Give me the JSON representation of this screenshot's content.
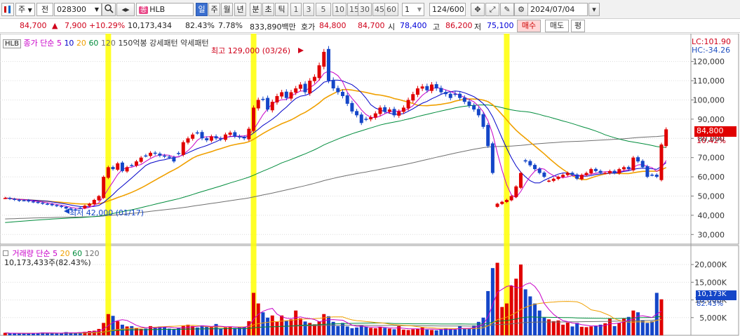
{
  "toolbar": {
    "market_type": "주",
    "scope": "전",
    "code": "028300",
    "stock_name": "HLB",
    "stock_badge": "종",
    "periods": [
      "일",
      "주",
      "월",
      "년",
      "분",
      "초",
      "틱"
    ],
    "active_period": "일",
    "intervals": [
      "1",
      "3",
      "5",
      "10",
      "15",
      "30",
      "45",
      "60"
    ],
    "interval_value": "1",
    "count": "124",
    "count_total": "/600",
    "date": "2024/07/04"
  },
  "quote": {
    "price": "84,700",
    "change_arrow": "▲",
    "change": "7,900",
    "change_pct": "+10.29%",
    "volume": "10,173,434",
    "volume_ratio": "82.43%",
    "turnover": "7.78%",
    "amount": "833,890백만",
    "ask_label": "호가",
    "ask": "84,800",
    "bid": "84,700",
    "open_label": "시",
    "open": "78,400",
    "high_label": "고",
    "high": "86,200",
    "low_label": "저",
    "low": "75,100",
    "buy_label": "매수",
    "sell_label": "매도",
    "avg_label": "평"
  },
  "price_panel": {
    "stock_tag": "HLB",
    "ma_label": "종가 단순",
    "ma_periods": [
      "5",
      "10",
      "20",
      "60",
      "120"
    ],
    "extra_label": "150억봉 강세패턴  약세패턴",
    "high_annotation": "최고 129,000 (03/26)",
    "low_annotation": "최저 42,000 (01/17)",
    "lc_label": "LC:101.90",
    "hc_label": "HC:-34.26",
    "last_price_tag": "84,800",
    "last_pct_tag": "10.42%",
    "colors": {
      "ma5": "#c800c8",
      "ma10": "#0000c8",
      "ma20": "#f0a000",
      "ma60": "#008c3c",
      "ma120": "#707070",
      "up": "#e00000",
      "down": "#1446c8",
      "highlight": "#ffff00"
    }
  },
  "volume_panel": {
    "label": "거래량",
    "ma_label": "단순",
    "ma_periods": [
      "5",
      "20",
      "60",
      "120"
    ],
    "current": "10,173,433주(82.43%)",
    "last_tag": "10,173K",
    "last_pct": "82.43%"
  },
  "chart_data": {
    "type": "candlestick",
    "price_axis": {
      "ticks": [
        30000,
        40000,
        50000,
        60000,
        70000,
        80000,
        90000,
        100000,
        110000,
        120000
      ],
      "tick_labels": [
        "30,000",
        "40,000",
        "50,000",
        "60,000",
        "70,000",
        "80,000",
        "90,000",
        "100,000",
        "110,000",
        "120,000"
      ],
      "ylim": [
        25000,
        133000
      ]
    },
    "volume_axis": {
      "ticks": [
        5000,
        10000,
        15000,
        20000
      ],
      "tick_labels": [
        "5,000K",
        "10,000K",
        "15,000K",
        "20,000K"
      ],
      "ylim": [
        0,
        23000
      ],
      "unit": "K"
    },
    "high": {
      "value": 129000,
      "date": "03/26"
    },
    "low": {
      "value": 42000,
      "date": "01/17"
    },
    "close_series": [
      49000,
      48500,
      48000,
      47500,
      47800,
      47200,
      46900,
      46500,
      46000,
      45800,
      45200,
      44800,
      44300,
      43500,
      43000,
      42800,
      43800,
      45000,
      46000,
      48000,
      50000,
      60000,
      65000,
      64000,
      67000,
      63000,
      65000,
      66000,
      68000,
      70000,
      71000,
      72500,
      72000,
      71000,
      70500,
      70000,
      68000,
      72000,
      78000,
      80000,
      82000,
      83000,
      80000,
      79000,
      81000,
      80000,
      79500,
      82000,
      83000,
      81000,
      80500,
      80000,
      85000,
      96000,
      100000,
      100500,
      95000,
      99000,
      102000,
      104000,
      101000,
      104000,
      106000,
      108000,
      104000,
      110000,
      112000,
      118000,
      125000,
      110000,
      106000,
      104000,
      102000,
      98000,
      94000,
      92000,
      88000,
      90000,
      91000,
      93000,
      96000,
      94000,
      95000,
      92000,
      94000,
      96000,
      100000,
      103000,
      106000,
      107000,
      105000,
      108000,
      106000,
      104000,
      103000,
      101000,
      103000,
      101000,
      99000,
      97000,
      95000,
      92000,
      86000,
      76000,
      62000,
      46000,
      47000,
      48000,
      50000,
      55000,
      62000,
      68000,
      66000,
      64000,
      62000,
      60000,
      58000,
      59000,
      60000,
      61000,
      62000,
      61000,
      59000,
      61000,
      62000,
      64000,
      63000,
      62000,
      62000,
      63000,
      62000,
      64000,
      65000,
      64000,
      70000,
      68000,
      65000,
      60000,
      61000,
      60000,
      76800,
      84700
    ],
    "volume_series": [
      700,
      500,
      600,
      500,
      550,
      650,
      600,
      700,
      800,
      600,
      550,
      500,
      600,
      900,
      800,
      700,
      850,
      1000,
      1200,
      1300,
      1800,
      3500,
      6000,
      5500,
      4000,
      3000,
      2500,
      2600,
      2000,
      1800,
      1900,
      2600,
      2200,
      2500,
      2400,
      1900,
      1600,
      2000,
      2800,
      3000,
      2600,
      2200,
      2800,
      2500,
      2400,
      3200,
      1900,
      2200,
      2500,
      2100,
      2200,
      2400,
      4000,
      12000,
      9000,
      6500,
      5000,
      5600,
      3800,
      5600,
      4200,
      4500,
      7000,
      4800,
      3900,
      3500,
      3100,
      3900,
      6000,
      5400,
      3800,
      2600,
      3500,
      2500,
      2000,
      2200,
      2800,
      2500,
      2100,
      2000,
      2400,
      2100,
      1900,
      1700,
      2600,
      1600,
      1500,
      1700,
      1800,
      2200,
      1600,
      1500,
      1400,
      1600,
      2000,
      1800,
      1600,
      2600,
      1800,
      2000,
      2800,
      3800,
      5000,
      12500,
      19000,
      20500,
      8000,
      9000,
      14000,
      16000,
      20000,
      13000,
      11000,
      9000,
      7000,
      5000,
      4500,
      4000,
      4200,
      3000,
      3600,
      2500,
      3500,
      2400,
      2300,
      2500,
      2700,
      3000,
      3400,
      4800,
      2600,
      3500,
      4800,
      5200,
      7000,
      6500,
      4200,
      3500,
      4000,
      12000,
      10173
    ],
    "up_days": [
      0,
      17,
      18,
      19,
      20,
      21,
      22,
      24,
      26,
      28,
      29,
      31,
      38,
      39,
      40,
      44,
      47,
      48,
      52,
      53,
      54,
      57,
      58,
      59,
      61,
      62,
      63,
      65,
      66,
      67,
      68,
      78,
      79,
      80,
      82,
      84,
      85,
      86,
      87,
      88,
      89,
      91,
      105,
      106,
      107,
      108,
      109,
      110,
      116,
      117,
      118,
      119,
      120,
      123,
      124,
      125,
      128,
      129,
      131,
      132,
      134,
      140,
      141
    ],
    "highlight_indices": [
      22,
      53,
      107
    ]
  }
}
